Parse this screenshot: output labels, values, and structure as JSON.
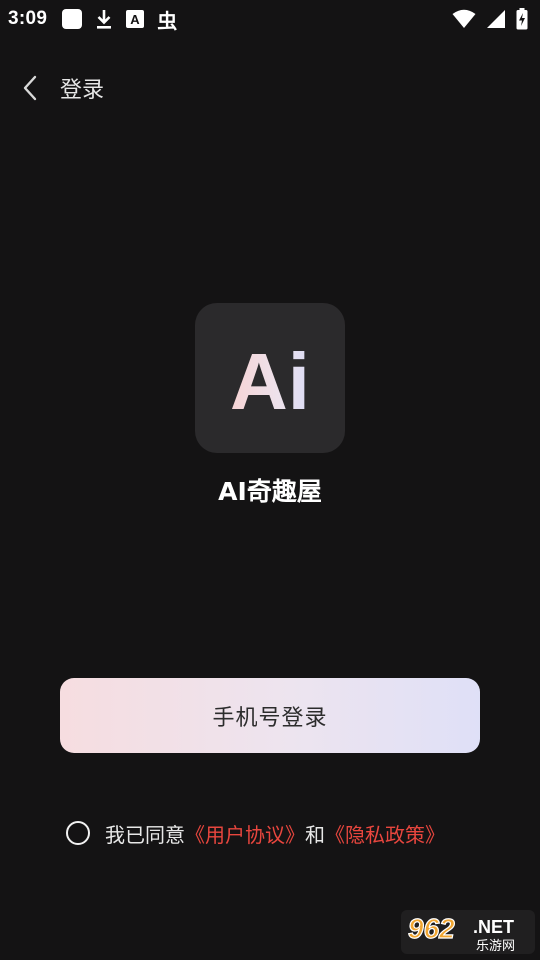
{
  "status_bar": {
    "time": "3:09",
    "left_icons": [
      "app-square-icon",
      "download-icon",
      "a-letter-icon",
      "bug-icon"
    ],
    "right_icons": [
      "wifi-icon",
      "cell-signal-icon",
      "battery-charging-icon"
    ],
    "a_glyph": "A",
    "bug_glyph": "虫"
  },
  "nav": {
    "title": "登录",
    "back_icon": "chevron-left-icon"
  },
  "app": {
    "logo_text": "Ai",
    "name": "AI奇趣屋"
  },
  "login": {
    "phone_button_label": "手机号登录"
  },
  "agreement": {
    "prefix": "我已同意",
    "user_agreement": "《用户协议》",
    "conjunction": "和",
    "privacy_policy": "《隐私政策》"
  },
  "watermark": {
    "number": "962",
    "suffix": ".NET",
    "site": "乐游网"
  },
  "colors": {
    "background": "#141314",
    "logo_tile": "#2b2a2c",
    "link_red": "#e8463e",
    "button_gradient_start": "#f6dde0",
    "button_gradient_end": "#dfe0f7"
  }
}
